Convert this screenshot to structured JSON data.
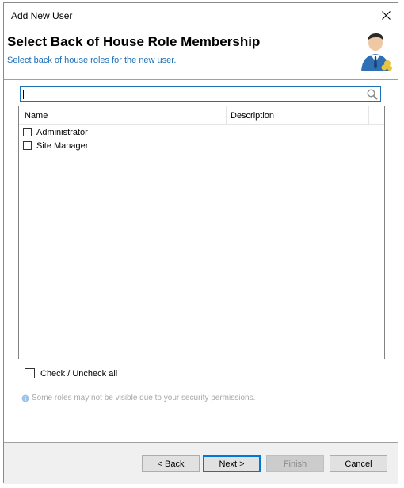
{
  "window": {
    "title": "Add New User"
  },
  "header": {
    "title": "Select Back of House Role Membership",
    "subtitle": "Select back of house roles for the new user.",
    "accent_color": "#1d6fb8"
  },
  "search": {
    "value": "",
    "placeholder": ""
  },
  "grid": {
    "columns": [
      "Name",
      "Description"
    ],
    "rows": [
      {
        "name": "Administrator",
        "description": "",
        "checked": false
      },
      {
        "name": "Site Manager",
        "description": "",
        "checked": false
      }
    ]
  },
  "check_all": {
    "label": "Check / Uncheck all",
    "checked": false
  },
  "info": {
    "text": "Some roles may not be visible due to your security permissions.",
    "icon": "info-icon"
  },
  "buttons": {
    "back": "< Back",
    "next": "Next >",
    "finish": "Finish",
    "cancel": "Cancel"
  },
  "icons": {
    "close": "close-icon",
    "search": "search-icon",
    "header_art": "user-roles-icon"
  }
}
